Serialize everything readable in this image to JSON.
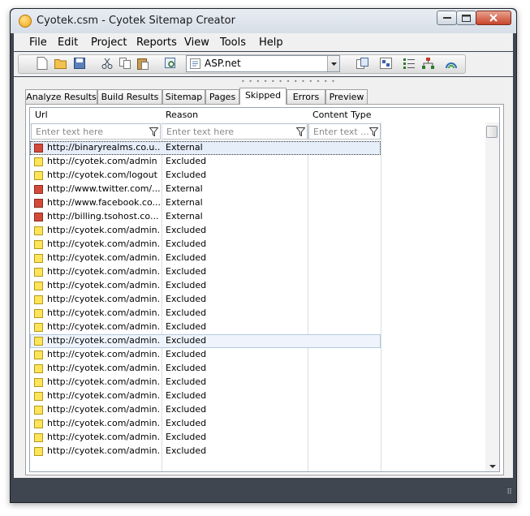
{
  "window": {
    "title": "Cyotek.csm - Cyotek Sitemap Creator"
  },
  "menu": [
    "File",
    "Edit",
    "Project",
    "Reports",
    "View",
    "Tools",
    "Help"
  ],
  "toolbar": {
    "combo_value": "ASP.net"
  },
  "tabs": [
    "Analyze Results",
    "Build Results",
    "Sitemap",
    "Pages",
    "Skipped",
    "Errors",
    "Preview"
  ],
  "active_tab": "Skipped",
  "grid": {
    "columns": [
      "Url",
      "Reason",
      "Content Type"
    ],
    "filter_placeholders": [
      "Enter text here",
      "Enter text here",
      "Enter text ..."
    ],
    "rows": [
      {
        "url": "http://binaryrealms.co.u...",
        "reason": "External",
        "status": "ext"
      },
      {
        "url": "http://cyotek.com/admin",
        "reason": "Excluded",
        "status": "exc"
      },
      {
        "url": "http://cyotek.com/logout",
        "reason": "Excluded",
        "status": "exc"
      },
      {
        "url": "http://www.twitter.com/...",
        "reason": "External",
        "status": "ext"
      },
      {
        "url": "http://www.facebook.co...",
        "reason": "External",
        "status": "ext"
      },
      {
        "url": "http://billing.tsohost.co...",
        "reason": "External",
        "status": "ext"
      },
      {
        "url": "http://cyotek.com/admin...",
        "reason": "Excluded",
        "status": "exc"
      },
      {
        "url": "http://cyotek.com/admin...",
        "reason": "Excluded",
        "status": "exc"
      },
      {
        "url": "http://cyotek.com/admin...",
        "reason": "Excluded",
        "status": "exc"
      },
      {
        "url": "http://cyotek.com/admin...",
        "reason": "Excluded",
        "status": "exc"
      },
      {
        "url": "http://cyotek.com/admin...",
        "reason": "Excluded",
        "status": "exc"
      },
      {
        "url": "http://cyotek.com/admin...",
        "reason": "Excluded",
        "status": "exc"
      },
      {
        "url": "http://cyotek.com/admin...",
        "reason": "Excluded",
        "status": "exc"
      },
      {
        "url": "http://cyotek.com/admin...",
        "reason": "Excluded",
        "status": "exc"
      },
      {
        "url": "http://cyotek.com/admin...",
        "reason": "Excluded",
        "status": "exc"
      },
      {
        "url": "http://cyotek.com/admin...",
        "reason": "Excluded",
        "status": "exc"
      },
      {
        "url": "http://cyotek.com/admin...",
        "reason": "Excluded",
        "status": "exc"
      },
      {
        "url": "http://cyotek.com/admin...",
        "reason": "Excluded",
        "status": "exc"
      },
      {
        "url": "http://cyotek.com/admin...",
        "reason": "Excluded",
        "status": "exc"
      },
      {
        "url": "http://cyotek.com/admin...",
        "reason": "Excluded",
        "status": "exc"
      },
      {
        "url": "http://cyotek.com/admin...",
        "reason": "Excluded",
        "status": "exc"
      },
      {
        "url": "http://cyotek.com/admin...",
        "reason": "Excluded",
        "status": "exc"
      },
      {
        "url": "http://cyotek.com/admin...",
        "reason": "Excluded",
        "status": "exc"
      }
    ]
  },
  "colors": {
    "external": "#d34a3a",
    "excluded": "#ffe45a",
    "chrome": "#3f4650"
  }
}
